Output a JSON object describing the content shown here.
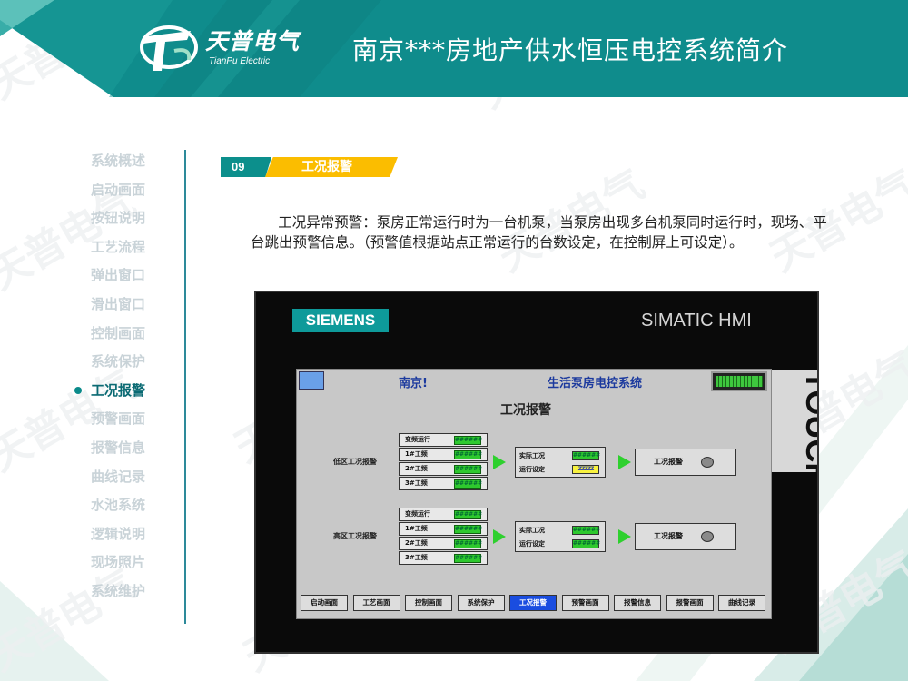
{
  "header": {
    "logo_main": "天普电气",
    "logo_sub": "TianPu Electric",
    "title": "南京***房地产供水恒压电控系统简介"
  },
  "colors": {
    "primary_teal": "#0c8f8c",
    "accent_yellow": "#fbbd00",
    "nav_inactive": "#c9d3d8",
    "nav_active": "#0a6a73"
  },
  "sidebar": {
    "items": [
      {
        "label": "系统概述",
        "active": false
      },
      {
        "label": "启动画面",
        "active": false
      },
      {
        "label": "按钮说明",
        "active": false
      },
      {
        "label": "工艺流程",
        "active": false
      },
      {
        "label": "弹出窗口",
        "active": false
      },
      {
        "label": "滑出窗口",
        "active": false
      },
      {
        "label": "控制画面",
        "active": false
      },
      {
        "label": "系统保护",
        "active": false
      },
      {
        "label": "工况报警",
        "active": true
      },
      {
        "label": "预警画面",
        "active": false
      },
      {
        "label": "报警信息",
        "active": false
      },
      {
        "label": "曲线记录",
        "active": false
      },
      {
        "label": "水池系统",
        "active": false
      },
      {
        "label": "逻辑说明",
        "active": false
      },
      {
        "label": "现场照片",
        "active": false
      },
      {
        "label": "系统维护",
        "active": false
      }
    ]
  },
  "section": {
    "number": "09",
    "title": "工况报警"
  },
  "description": "工况异常预警：泵房正常运行时为一台机泵，当泵房出现多台机泵同时运行时，现场、平台跳出预警信息。（预警值根据站点正常运行的台数设定，在控制屏上可设定）。",
  "hmi": {
    "brand": "SIEMENS",
    "model": "SIMATIC HMI",
    "touch_label": "TOUCH",
    "screen": {
      "location": "南京!",
      "system_name": "生活泵房电控系统",
      "title": "工况报警",
      "zones": [
        {
          "label": "低区工况报警",
          "rows": [
            {
              "label": "变频运行",
              "status": "######"
            },
            {
              "label": "1#工频",
              "status": "######"
            },
            {
              "label": "2#工频",
              "status": "######"
            },
            {
              "label": "3#工频",
              "status": "######"
            }
          ],
          "actual_label": "实际工况",
          "actual_value": "######",
          "setting_label": "运行设定",
          "setting_value": "ZZZZZ",
          "alarm_label": "工况报警"
        },
        {
          "label": "高区工况报警",
          "rows": [
            {
              "label": "变频运行",
              "status": "######"
            },
            {
              "label": "1#工频",
              "status": "######"
            },
            {
              "label": "2#工频",
              "status": "######"
            },
            {
              "label": "3#工频",
              "status": "######"
            }
          ],
          "actual_label": "实际工况",
          "actual_value": "######",
          "setting_label": "运行设定",
          "setting_value": "######",
          "alarm_label": "工况报警"
        }
      ],
      "nav_buttons": [
        {
          "label": "启动画面",
          "active": false
        },
        {
          "label": "工艺画面",
          "active": false
        },
        {
          "label": "控制画面",
          "active": false
        },
        {
          "label": "系统保护",
          "active": false
        },
        {
          "label": "工况报警",
          "active": true
        },
        {
          "label": "预警画面",
          "active": false
        },
        {
          "label": "报警信息",
          "active": false
        },
        {
          "label": "报警画面",
          "active": false
        },
        {
          "label": "曲线记录",
          "active": false
        }
      ]
    }
  },
  "watermark": "天普电气"
}
